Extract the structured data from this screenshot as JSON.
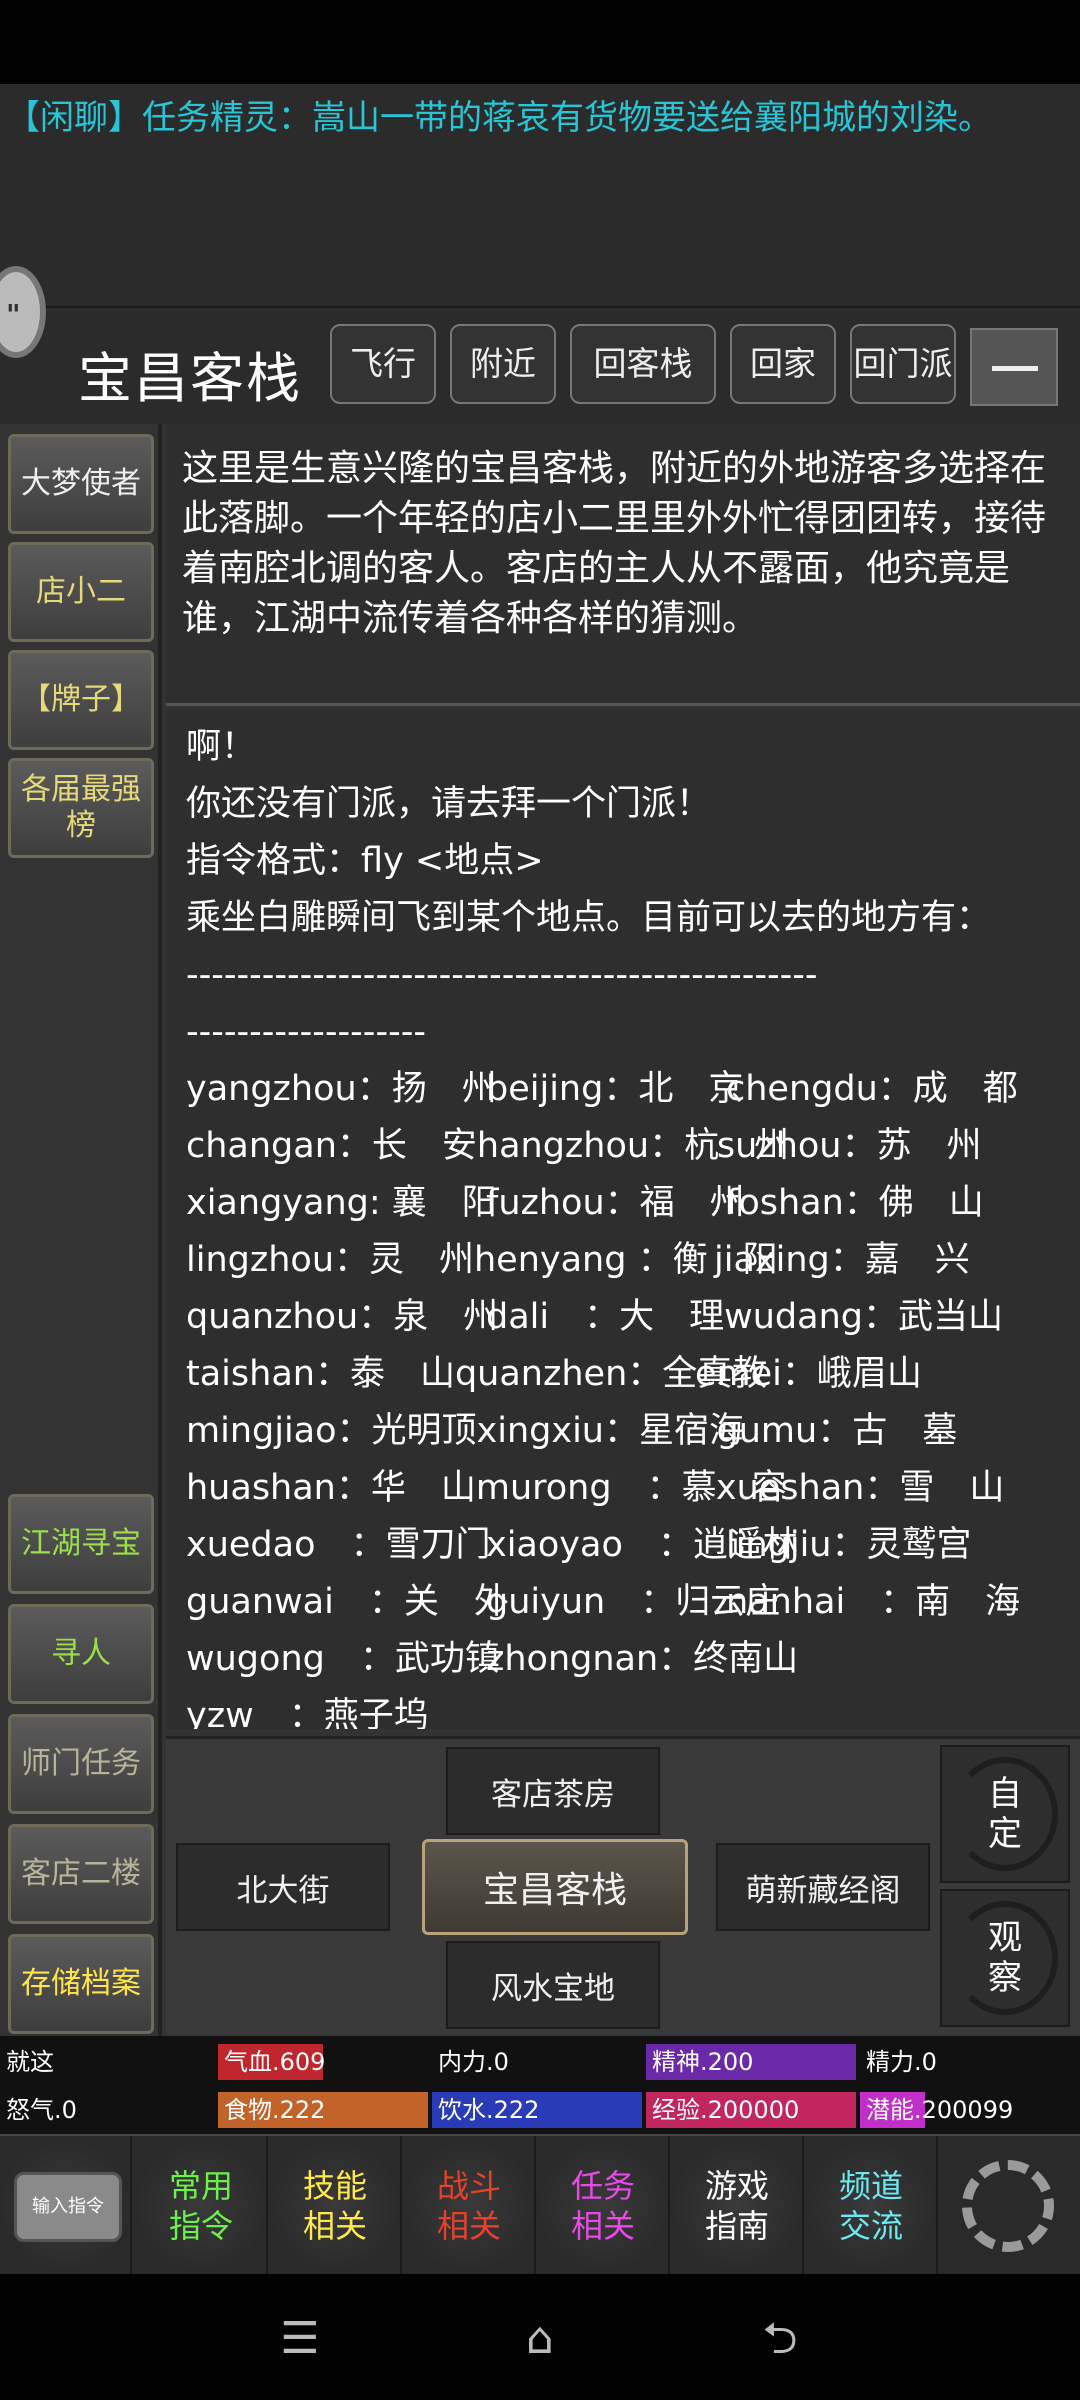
{
  "chat": {
    "tag": "【闲聊】",
    "text": "任务精灵：嵩山一带的蒋哀有货物要送给襄阳城的刘染。"
  },
  "location": {
    "title": "宝昌客栈",
    "buttons": [
      "飞行",
      "附近",
      "回客栈",
      "回家",
      "回门派"
    ]
  },
  "sidebar": {
    "npcs": [
      "大梦使者",
      "店小二",
      "【牌子】",
      "各届最强榜"
    ],
    "actions": [
      "江湖寻宝",
      "寻人",
      "师门任务",
      "客店二楼",
      "存储档案"
    ]
  },
  "description": "这里是生意兴隆的宝昌客栈，附近的外地游客多选择在此落脚。一个年轻的店小二里里外外忙得团团转，接待着南腔北调的客人。客店的主人从不露面，他究竟是谁，江湖中流传着各种各样的猜测。",
  "messages": {
    "line1": "啊！",
    "line2": "你还没有门派，请去拜一个门派！",
    "line3": "指令格式：fly <地点>",
    "line4": "乘坐白雕瞬间飞到某个地点。目前可以去的地方有：",
    "divider1": "--------------------------------------------------",
    "divider2": "-------------------",
    "destinations": [
      "yangzhou：扬　州",
      "beijing：北　京",
      "chengdu：成　都",
      "changan：长　安",
      "hangzhou：杭　州",
      "suzhou：苏　州",
      "xiangyang: 襄　阳",
      "fuzhou：福　州",
      "foshan：佛　山",
      "lingzhou：灵　州",
      "henyang ：衡　阳",
      "jiaxing：嘉　兴",
      "quanzhou：泉　州",
      "dali　：大　理",
      "wudang：武当山",
      "taishan：泰　山",
      "quanzhen：全真教",
      "emei：峨眉山",
      "mingjiao：光明顶",
      "xingxiu：星宿海",
      "gumu：古　墓",
      "huashan：华　山",
      "murong　：慕　容",
      "xueshan：雪　山",
      "xuedao　：雪刀门",
      "xiaoyao　：逍遥林",
      "lingjiu：灵鹫宫",
      "guanwai　：关　外",
      "guiyun　：归云庄",
      "nanhai　：南　海",
      "wugong　：武功镇",
      "zhongnan：终南山",
      "yzw　：燕子坞"
    ]
  },
  "nav": {
    "north": "客店茶房",
    "west": "北大街",
    "center": "宝昌客栈",
    "east": "萌新藏经阁",
    "south": "风水宝地",
    "custom": "自定",
    "observe": "观察"
  },
  "stats": {
    "row1": [
      {
        "label": "就这",
        "fill": 0,
        "color": "#111111"
      },
      {
        "label": "气血.609",
        "fill": 0.5,
        "color": "#c0262e"
      },
      {
        "label": "内力.0",
        "fill": 0,
        "color": "#1e3aa8"
      },
      {
        "label": "精神.200",
        "fill": 1.0,
        "color": "#6a2aa8"
      },
      {
        "label": "精力.0",
        "fill": 0,
        "color": "#111111"
      }
    ],
    "row2": [
      {
        "label": "怒气.0",
        "fill": 0,
        "color": "#111111"
      },
      {
        "label": "食物.222",
        "fill": 1.0,
        "color": "#c2642a"
      },
      {
        "label": "饮水.222",
        "fill": 1.0,
        "color": "#2a3bb8"
      },
      {
        "label": "经验.200000",
        "fill": 1.0,
        "color": "#c2265e"
      },
      {
        "label": "潜能.200099",
        "fill": 0.3,
        "color": "#c02fc8"
      }
    ]
  },
  "menu": {
    "input_cmd": "输入指令",
    "items": [
      {
        "label": "常用\n指令",
        "color": "#6cf04a"
      },
      {
        "label": "技能\n相关",
        "color": "#ffe94a"
      },
      {
        "label": "战斗\n相关",
        "color": "#e8402a"
      },
      {
        "label": "任务\n相关",
        "color": "#e84ae8"
      },
      {
        "label": "游戏\n指南",
        "color": "#ffffff"
      },
      {
        "label": "频道\n交流",
        "color": "#6ee8f0"
      }
    ]
  }
}
